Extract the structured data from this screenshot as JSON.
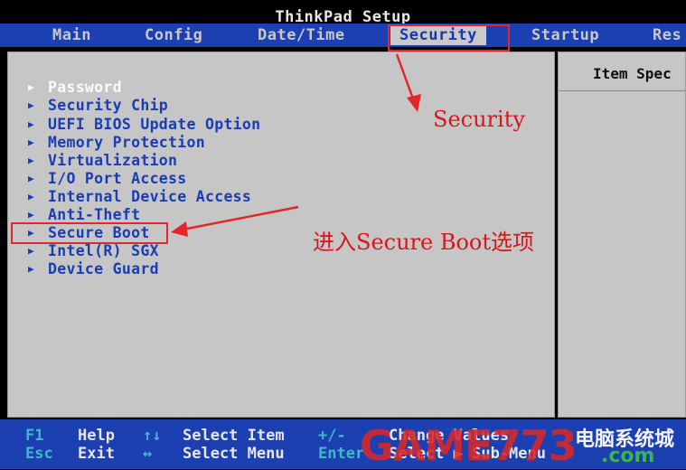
{
  "window": {
    "title": "ThinkPad Setup"
  },
  "tabs": [
    {
      "label": "Main",
      "active": false
    },
    {
      "label": "Config",
      "active": false
    },
    {
      "label": "Date/Time",
      "active": false
    },
    {
      "label": "Security",
      "active": true
    },
    {
      "label": "Startup",
      "active": false
    },
    {
      "label": "Res",
      "active": false
    }
  ],
  "menu": {
    "items": [
      {
        "label": "Password",
        "selected": true
      },
      {
        "label": "Security Chip",
        "selected": false
      },
      {
        "label": "UEFI BIOS Update Option",
        "selected": false
      },
      {
        "label": "Memory Protection",
        "selected": false
      },
      {
        "label": "Virtualization",
        "selected": false
      },
      {
        "label": "I/O Port Access",
        "selected": false
      },
      {
        "label": "Internal Device Access",
        "selected": false
      },
      {
        "label": "Anti-Theft",
        "selected": false
      },
      {
        "label": "Secure Boot",
        "selected": false,
        "highlighted": true
      },
      {
        "label": "Intel(R) SGX",
        "selected": false
      },
      {
        "label": "Device Guard",
        "selected": false
      }
    ]
  },
  "help_panel": {
    "title": "Item Spec"
  },
  "annotations": {
    "security_note": "Security",
    "secure_boot_note": "进入Secure Boot选项",
    "color": "#d9151b"
  },
  "footer": {
    "row1": [
      {
        "key": "F1",
        "desc": "Help"
      },
      {
        "key": "↑↓",
        "desc": "Select Item"
      },
      {
        "key": "+/-",
        "desc": "Change Values"
      }
    ],
    "row2": [
      {
        "key": "Esc",
        "desc": "Exit"
      },
      {
        "key": "↔",
        "desc": "Select Menu"
      },
      {
        "key": "Enter",
        "desc": "Select ▶ Sub-Menu"
      }
    ]
  },
  "watermark": {
    "brand": "GAME773",
    "cn": "电脑系统城",
    "domain": ".com"
  },
  "colors": {
    "accent_blue": "#1c3fb2",
    "panel_gray": "#c6c6c6",
    "annotation_red": "#e3262c"
  }
}
